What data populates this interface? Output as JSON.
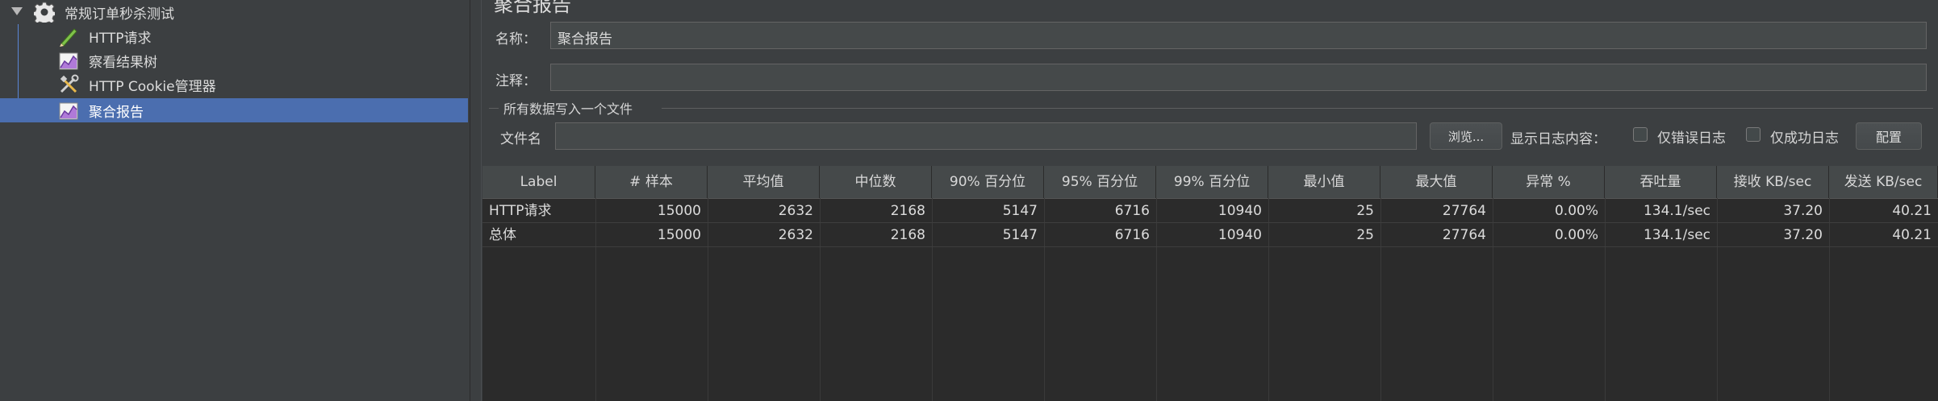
{
  "tree": {
    "root_label": "常规订单秒杀测试",
    "items": [
      {
        "label": "HTTP请求",
        "icon": "pen-icon"
      },
      {
        "label": "察看结果树",
        "icon": "chart-icon"
      },
      {
        "label": "HTTP Cookie管理器",
        "icon": "tools-icon"
      },
      {
        "label": "聚合报告",
        "icon": "chart-icon",
        "selected": true
      }
    ]
  },
  "panel": {
    "title": "聚合报告",
    "name_label": "名称：",
    "name_value": "聚合报告",
    "comment_label": "注释：",
    "comment_value": "",
    "group_title": "所有数据写入一个文件",
    "filename_label": "文件名",
    "filename_value": "",
    "browse_button": "浏览...",
    "log_content_label": "显示日志内容：",
    "errors_only_label": "仅错误日志",
    "success_only_label": "仅成功日志",
    "configure_button": "配置"
  },
  "table": {
    "headers": [
      "Label",
      "# 样本",
      "平均值",
      "中位数",
      "90% 百分位",
      "95% 百分位",
      "99% 百分位",
      "最小值",
      "最大值",
      "异常 %",
      "吞吐量",
      "接收 KB/sec",
      "发送 KB/sec"
    ],
    "rows": [
      [
        "HTTP请求",
        "15000",
        "2632",
        "2168",
        "5147",
        "6716",
        "10940",
        "25",
        "27764",
        "0.00%",
        "134.1/sec",
        "37.20",
        "40.21"
      ],
      [
        "总体",
        "15000",
        "2632",
        "2168",
        "5147",
        "6716",
        "10940",
        "25",
        "27764",
        "0.00%",
        "134.1/sec",
        "37.20",
        "40.21"
      ]
    ]
  },
  "colors": {
    "background": "#3c3f41",
    "selection": "#4b6eaf",
    "table_bg": "#2b2b2b"
  }
}
